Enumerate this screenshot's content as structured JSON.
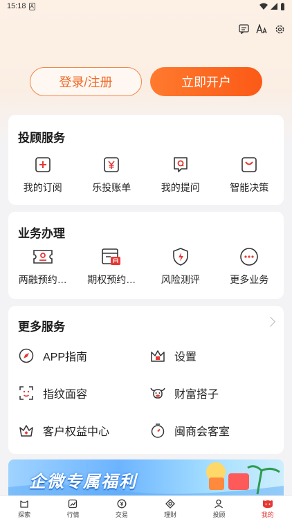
{
  "status_bar": {
    "time": "15:18",
    "badge": "A"
  },
  "header": {
    "login_label": "登录/注册",
    "open_account_label": "立即开户"
  },
  "advisory": {
    "title": "投顾服务",
    "items": [
      {
        "label": "我的订阅",
        "icon": "plus-box-icon"
      },
      {
        "label": "乐投账单",
        "icon": "yen-box-icon"
      },
      {
        "label": "我的提问",
        "icon": "question-chat-icon"
      },
      {
        "label": "智能决策",
        "icon": "bag-icon"
      }
    ]
  },
  "business": {
    "title": "业务办理",
    "items": [
      {
        "label": "两融预约…",
        "icon": "ticket-icon"
      },
      {
        "label": "期权预约…",
        "icon": "calendar-period-icon"
      },
      {
        "label": "风险测评",
        "icon": "shield-lightning-icon"
      },
      {
        "label": "更多业务",
        "icon": "more-dots-icon"
      }
    ]
  },
  "more_services": {
    "title": "更多服务",
    "items": [
      {
        "label": "APP指南",
        "icon": "compass-icon"
      },
      {
        "label": "设置",
        "icon": "crown-icon"
      },
      {
        "label": "指纹面容",
        "icon": "face-id-icon"
      },
      {
        "label": "财富搭子",
        "icon": "cow-icon"
      },
      {
        "label": "客户权益中心",
        "icon": "crown-gift-icon"
      },
      {
        "label": "闽商会客室",
        "icon": "stopwatch-icon"
      }
    ]
  },
  "banner": {
    "text": "企微专属福利"
  },
  "nav": {
    "items": [
      {
        "label": "探索",
        "icon": "explore-icon"
      },
      {
        "label": "行情",
        "icon": "chart-icon"
      },
      {
        "label": "交易",
        "icon": "trade-icon"
      },
      {
        "label": "理财",
        "icon": "wealth-icon"
      },
      {
        "label": "投顾",
        "icon": "advisor-icon"
      },
      {
        "label": "我的",
        "icon": "mine-icon"
      }
    ],
    "active": "我的"
  },
  "colors": {
    "accent": "#fb5a17",
    "icon_red": "#e53935",
    "nav_active": "#e53935"
  }
}
